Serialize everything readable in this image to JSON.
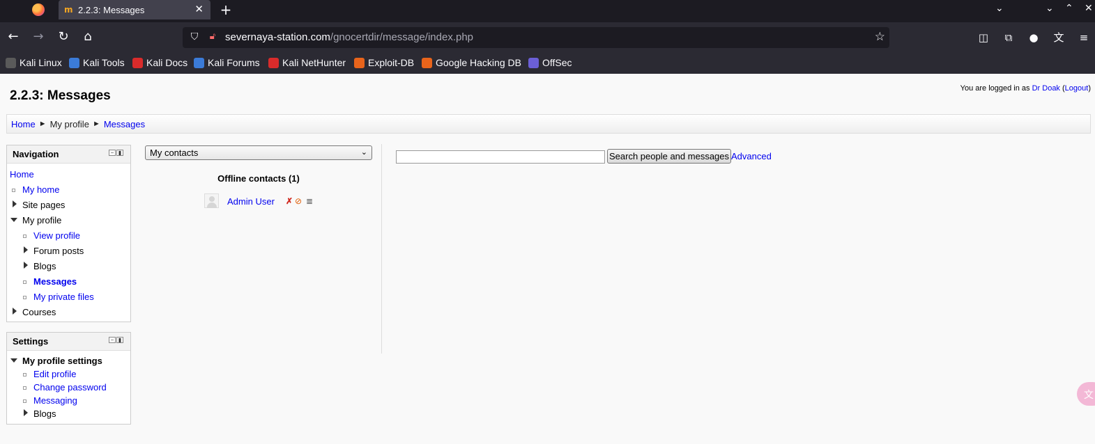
{
  "browser": {
    "tab_title": "2.2.3: Messages",
    "new_tab": "+",
    "url_domain": "severnaya-station.com",
    "url_path": "/gnocertdir/message/index.php",
    "bookmarks": [
      {
        "label": "Kali Linux",
        "color": "#5a5a5a"
      },
      {
        "label": "Kali Tools",
        "color": "#3b7bd8"
      },
      {
        "label": "Kali Docs",
        "color": "#d92b2b"
      },
      {
        "label": "Kali Forums",
        "color": "#3b7bd8"
      },
      {
        "label": "Kali NetHunter",
        "color": "#d92b2b"
      },
      {
        "label": "Exploit-DB",
        "color": "#e8641b"
      },
      {
        "label": "Google Hacking DB",
        "color": "#e8641b"
      },
      {
        "label": "OffSec",
        "color": "#6b5fd6"
      }
    ]
  },
  "page": {
    "title": "2.2.3: Messages",
    "login": {
      "prefix": "You are logged in as ",
      "user": "Dr Doak",
      "open_paren": " (",
      "logout": "Logout",
      "close_paren": ")"
    },
    "breadcrumb": {
      "home": "Home",
      "sep": "►",
      "profile": "My profile",
      "messages": "Messages"
    }
  },
  "navigation": {
    "title": "Navigation",
    "home": "Home",
    "my_home": "My home",
    "site_pages": "Site pages",
    "my_profile": "My profile",
    "view_profile": "View profile",
    "forum_posts": "Forum posts",
    "blogs": "Blogs",
    "messages": "Messages",
    "private_files": "My private files",
    "courses": "Courses"
  },
  "settings": {
    "title": "Settings",
    "profile_settings": "My profile settings",
    "edit_profile": "Edit profile",
    "change_password": "Change password",
    "messaging": "Messaging",
    "blogs": "Blogs"
  },
  "messages": {
    "contacts_select": "My contacts",
    "offline_heading": "Offline contacts (1)",
    "contact_name": "Admin User",
    "search_value": "",
    "search_button": "Search people and messages",
    "advanced": "Advanced"
  },
  "colors": {
    "link": "#0000ee",
    "chrome_dark": "#1c1b22",
    "chrome": "#2b2a33"
  }
}
